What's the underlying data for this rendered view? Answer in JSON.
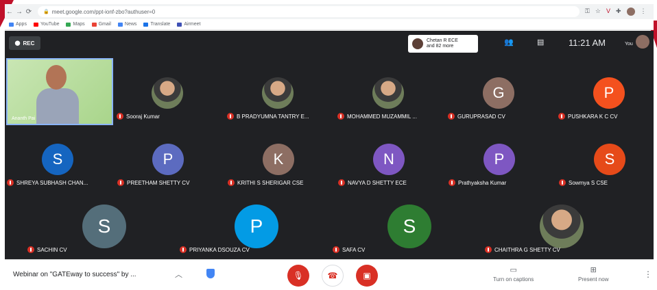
{
  "browser": {
    "url": "meet.google.com/ppt-ionf-zbo?authuser=0",
    "bookmarks": [
      {
        "label": "Apps",
        "color": "#4285f4"
      },
      {
        "label": "YouTube",
        "color": "#ff0000"
      },
      {
        "label": "Maps",
        "color": "#34a853"
      },
      {
        "label": "Gmail",
        "color": "#ea4335"
      },
      {
        "label": "News",
        "color": "#4285f4"
      },
      {
        "label": "Translate",
        "color": "#1a73e8"
      },
      {
        "label": "Airmeet",
        "color": "#3f51b5"
      }
    ]
  },
  "topbar": {
    "rec_label": "REC",
    "joiner_line1": "Chetan R ECE",
    "joiner_line2": "and 82 more",
    "time": "11:21 AM",
    "you_label": "You"
  },
  "speaker": {
    "name": "Ananth Pai"
  },
  "row1": [
    {
      "name": "Sooraj Kumar",
      "kind": "photo"
    },
    {
      "name": "B PRADYUMNA TANTRY E...",
      "kind": "photo"
    },
    {
      "name": "MOHAMMED MUZAMMIL ...",
      "kind": "photo"
    },
    {
      "name": "GURUPRASAD CV",
      "initial": "G",
      "color": "#8d6e63"
    },
    {
      "name": "PUSHKARA K C CV",
      "initial": "P",
      "color": "#f4511e"
    }
  ],
  "row2": [
    {
      "name": "SHREYA SUBHASH CHAN...",
      "initial": "S",
      "color": "#1565c0"
    },
    {
      "name": "PREETHAM SHETTY CV",
      "initial": "P",
      "color": "#5c6bc0"
    },
    {
      "name": "KRITHI S SHERIGAR CSE",
      "initial": "K",
      "color": "#8d6e63"
    },
    {
      "name": "NAVYA D SHETTY ECE",
      "initial": "N",
      "color": "#7e57c2"
    },
    {
      "name": "Prathyaksha Kumar",
      "initial": "P",
      "color": "#7e57c2"
    },
    {
      "name": "Sowmya S CSE",
      "initial": "S",
      "color": "#e64a19"
    }
  ],
  "row3": [
    {
      "name": "SACHIN CV",
      "initial": "S",
      "color": "#546e7a"
    },
    {
      "name": "PRIYANKA DSOUZA CV",
      "initial": "P",
      "color": "#039be5"
    },
    {
      "name": "SAFA CV",
      "initial": "S",
      "color": "#2e7d32"
    },
    {
      "name": "CHAITHRA G SHETTY CV",
      "kind": "photo"
    }
  ],
  "bottom": {
    "meeting_title": "Webinar on \"GATEway to success\" by ...",
    "captions_label": "Turn on captions",
    "present_label": "Present now"
  }
}
